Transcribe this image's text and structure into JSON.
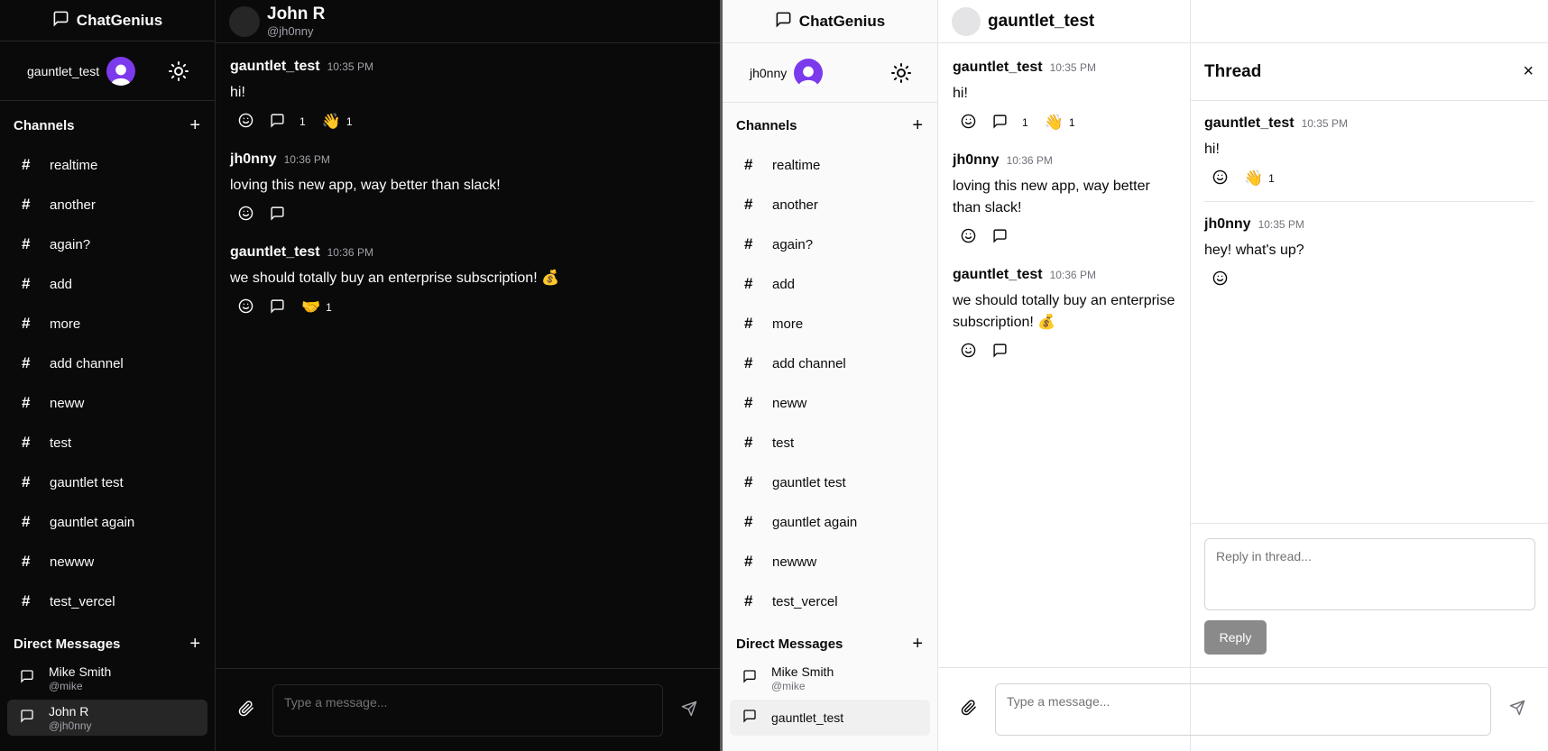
{
  "colors": {
    "dark_bg": "#0a0a0a",
    "light_bg": "#ffffff",
    "accent_avatar": "#7c3aed",
    "reply_button": "#8a8a8a"
  },
  "dark": {
    "app_name": "ChatGenius",
    "username": "gauntlet_test",
    "channels_title": "Channels",
    "channels": [
      "realtime",
      "another",
      "again?",
      "add",
      "more",
      "add channel",
      "neww",
      "test",
      "gauntlet test",
      "gauntlet again",
      "newww",
      "test_vercel"
    ],
    "dm_title": "Direct Messages",
    "dms": [
      {
        "name": "Mike Smith",
        "handle": "@mike"
      },
      {
        "name": "John R",
        "handle": "@jh0nny"
      }
    ],
    "header": {
      "name": "John R",
      "handle": "@jh0nny"
    },
    "messages": [
      {
        "author": "gauntlet_test",
        "time": "10:35 PM",
        "text": "hi!",
        "replies": "1",
        "reaction": "👋",
        "reaction_count": "1"
      },
      {
        "author": "jh0nny",
        "time": "10:36 PM",
        "text": "loving this new app, way better than slack!"
      },
      {
        "author": "gauntlet_test",
        "time": "10:36 PM",
        "text": "we should totally buy an enterprise subscription! 💰",
        "reaction": "🤝",
        "reaction_count": "1"
      }
    ],
    "composer_placeholder": "Type a message..."
  },
  "light": {
    "app_name": "ChatGenius",
    "username": "jh0nny",
    "channels_title": "Channels",
    "channels": [
      "realtime",
      "another",
      "again?",
      "add",
      "more",
      "add channel",
      "neww",
      "test",
      "gauntlet test",
      "gauntlet again",
      "newww",
      "test_vercel"
    ],
    "dm_title": "Direct Messages",
    "dms": [
      {
        "name": "Mike Smith",
        "handle": "@mike"
      },
      {
        "name": "gauntlet_test",
        "handle": ""
      }
    ],
    "header": {
      "name": "gauntlet_test"
    },
    "messages": [
      {
        "author": "gauntlet_test",
        "time": "10:35 PM",
        "text": "hi!",
        "replies": "1",
        "reaction": "👋",
        "reaction_count": "1"
      },
      {
        "author": "jh0nny",
        "time": "10:36 PM",
        "text": "loving this new app, way better than slack!"
      },
      {
        "author": "gauntlet_test",
        "time": "10:36 PM",
        "text": "we should totally buy an enterprise subscription! 💰"
      }
    ],
    "composer_placeholder": "Type a message...",
    "thread": {
      "title": "Thread",
      "close": "×",
      "parent": {
        "author": "gauntlet_test",
        "time": "10:35 PM",
        "text": "hi!",
        "reaction": "👋",
        "reaction_count": "1"
      },
      "replies": [
        {
          "author": "jh0nny",
          "time": "10:35 PM",
          "text": "hey! what's up?"
        }
      ],
      "reply_placeholder": "Reply in thread...",
      "reply_button": "Reply"
    }
  }
}
